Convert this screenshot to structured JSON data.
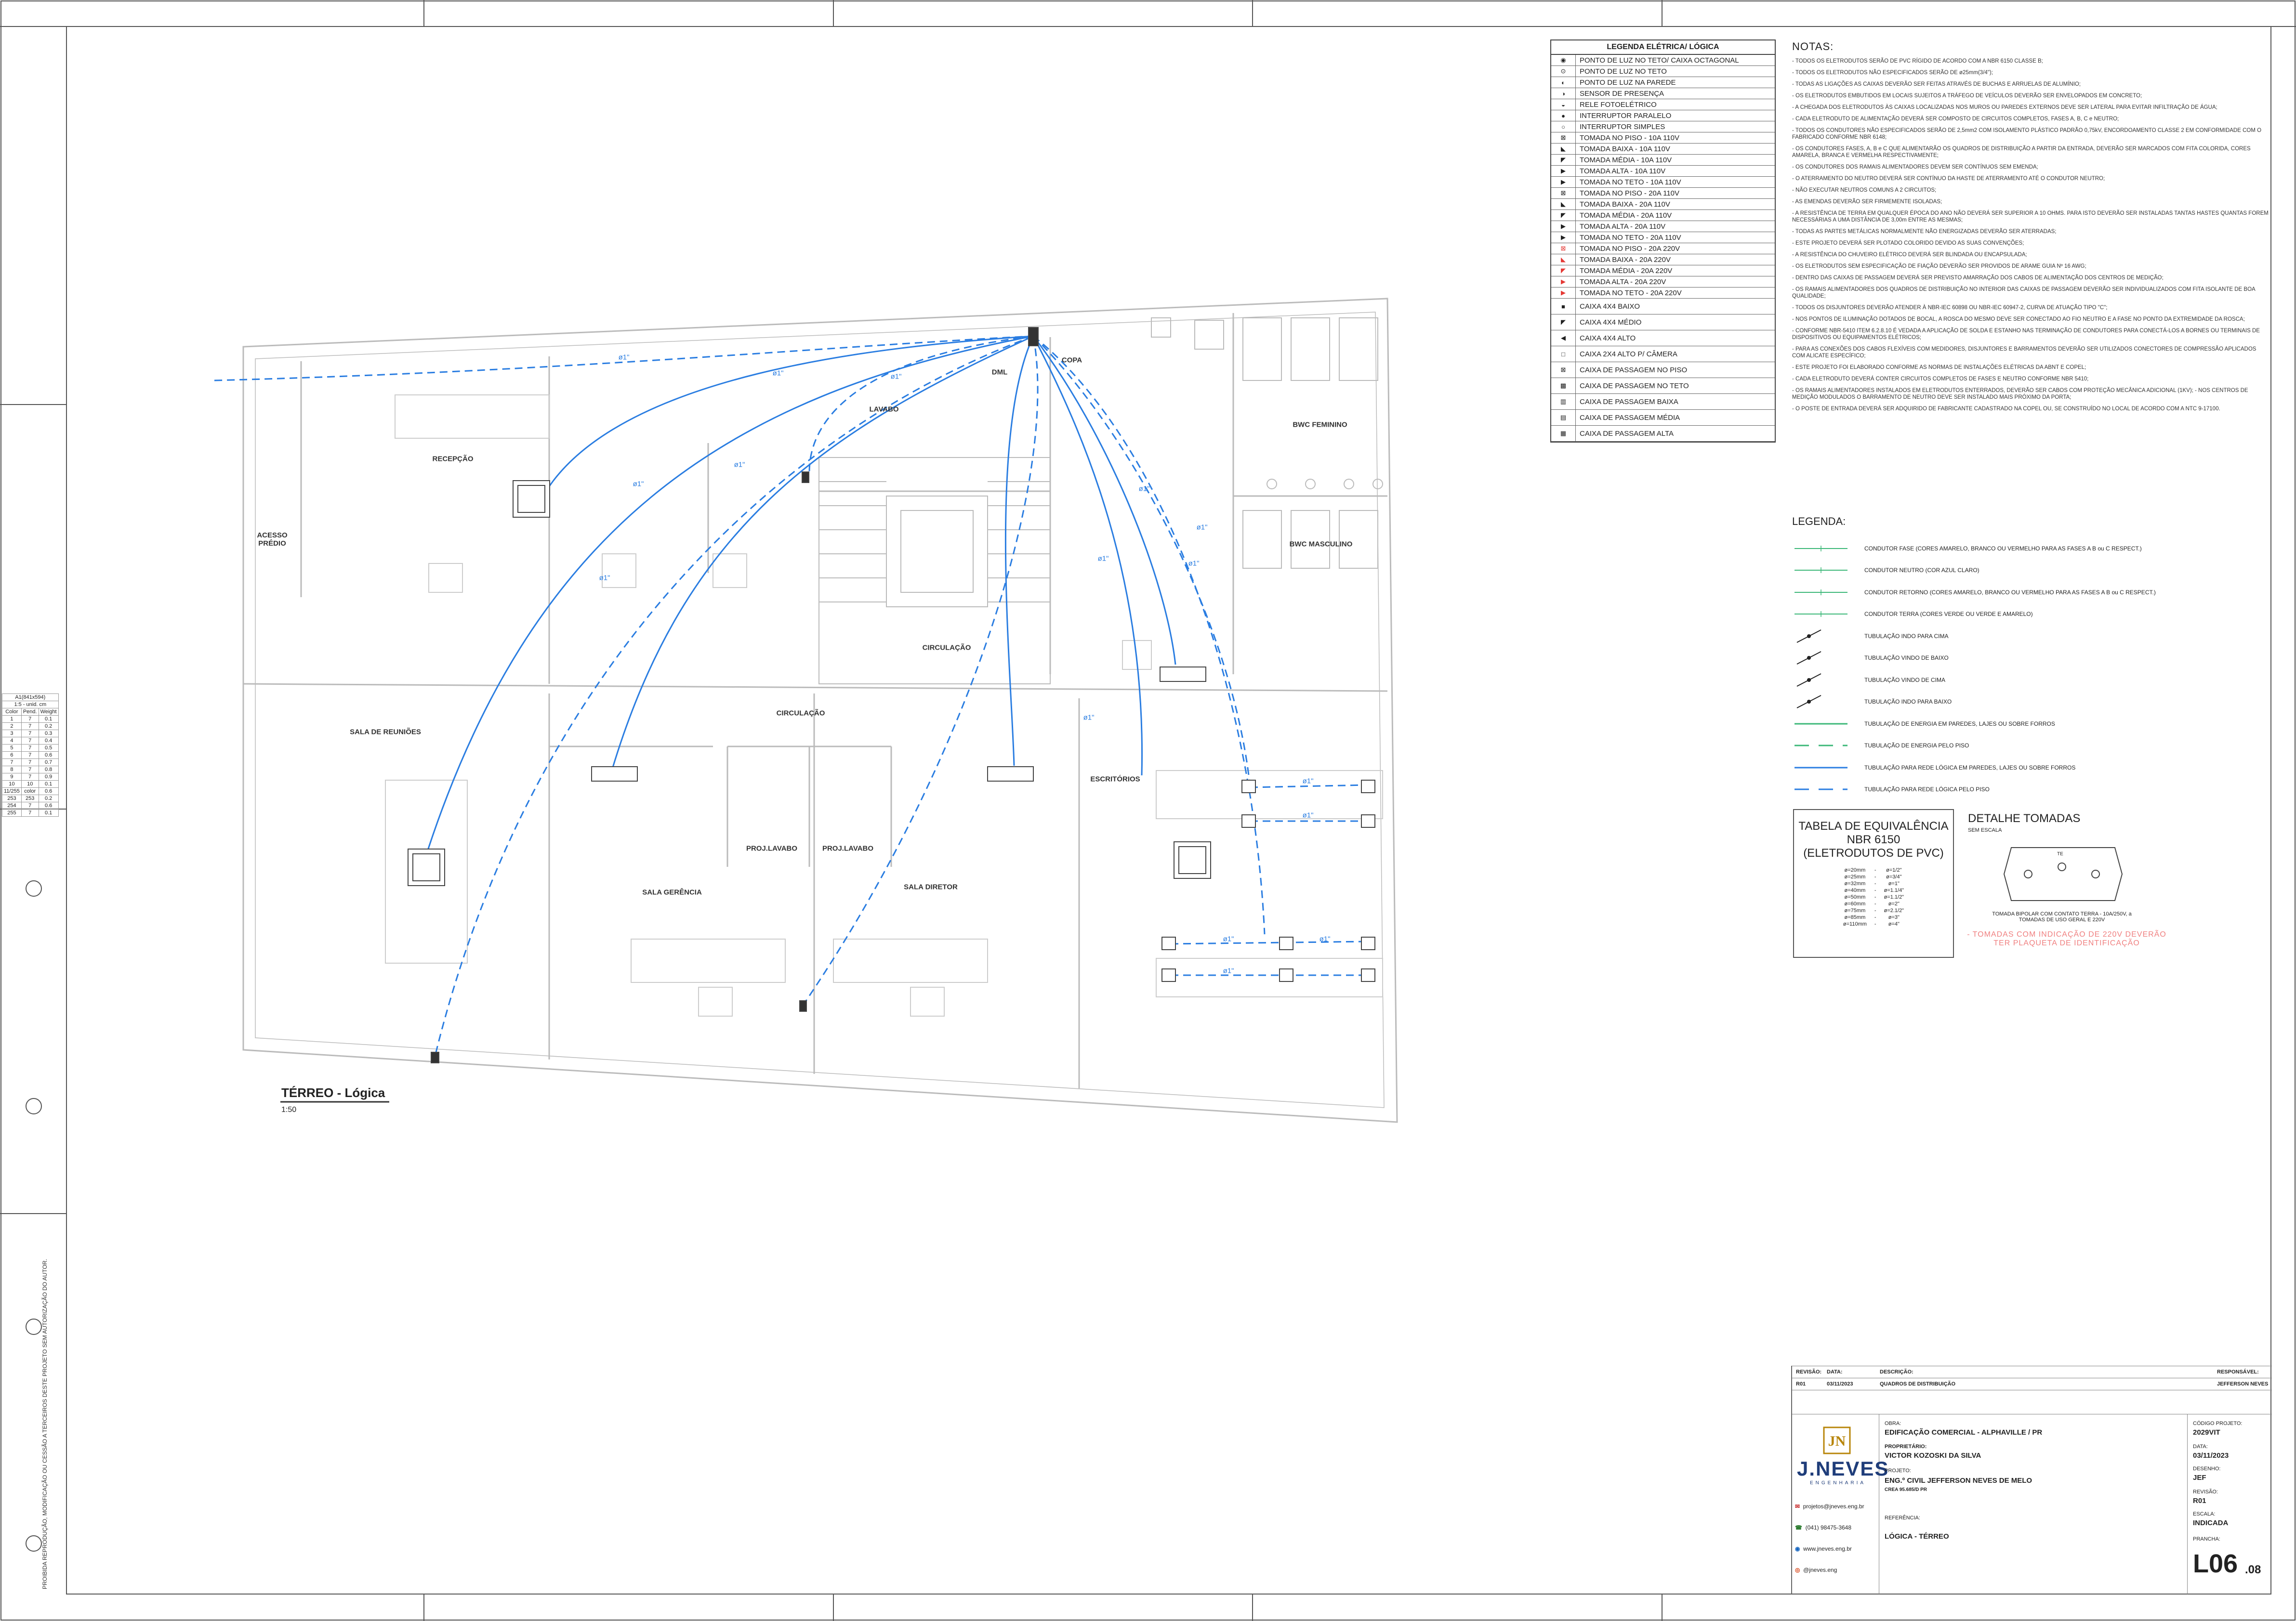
{
  "drawing": {
    "title": "TÉRREO - Lógica",
    "scale": "1:50"
  },
  "rooms": [
    {
      "key": "acesso",
      "label": "ACESSO PRÉDIO"
    },
    {
      "key": "recepcao",
      "label": "RECEPÇÃO"
    },
    {
      "key": "lavabo",
      "label": "LAVABO"
    },
    {
      "key": "dml",
      "label": "DML"
    },
    {
      "key": "copa",
      "label": "COPA"
    },
    {
      "key": "bwc_fem",
      "label": "BWC FEMININO"
    },
    {
      "key": "bwc_masc",
      "label": "BWC MASCULINO"
    },
    {
      "key": "circ1",
      "label": "CIRCULAÇÃO"
    },
    {
      "key": "circ2",
      "label": "CIRCULAÇÃO"
    },
    {
      "key": "reunioes",
      "label": "SALA DE REUNIÕES"
    },
    {
      "key": "escritorios",
      "label": "ESCRITÓRIOS"
    },
    {
      "key": "proj1",
      "label": "PROJ.LAVABO"
    },
    {
      "key": "proj2",
      "label": "PROJ.LAVABO"
    },
    {
      "key": "gerencia",
      "label": "SALA GERÊNCIA"
    },
    {
      "key": "diretor",
      "label": "SALA DIRETOR"
    }
  ],
  "conduit_labels": [
    "ø1\"",
    "ø1\"",
    "ø1\"",
    "ø1\"",
    "ø1\"",
    "ø1\"",
    "ø1\"",
    "ø1\"",
    "ø1\"",
    "ø1\"",
    "ø1\"",
    "ø1\"",
    "ø1\"",
    "ø1\"",
    "ø1\"",
    "ø1\""
  ],
  "legend_table": {
    "title": "LEGENDA ELÉTRICA/ LÓGICA",
    "items": [
      "PONTO DE LUZ NO TETO/ CAIXA OCTAGONAL",
      "PONTO DE LUZ NO TETO",
      "PONTO DE LUZ NA PAREDE",
      "SENSOR DE PRESENÇA",
      "RELE FOTOELÉTRICO",
      "INTERRUPTOR PARALELO",
      "INTERRUPTOR SIMPLES",
      "TOMADA NO PISO - 10A 110V",
      "TOMADA BAIXA - 10A 110V",
      "TOMADA MÉDIA - 10A 110V",
      "TOMADA ALTA - 10A 110V",
      "TOMADA NO TETO - 10A 110V",
      "TOMADA NO PISO - 20A 110V",
      "TOMADA BAIXA - 20A 110V",
      "TOMADA MÉDIA - 20A 110V",
      "TOMADA ALTA - 20A 110V",
      "TOMADA NO TETO - 20A 110V",
      "TOMADA NO PISO - 20A 220V",
      "TOMADA BAIXA - 20A 220V",
      "TOMADA MÉDIA - 20A 220V",
      "TOMADA ALTA - 20A 220V",
      "TOMADA NO TETO - 20A 220V",
      "CAIXA 4X4 BAIXO",
      "CAIXA 4X4 MÉDIO",
      "CAIXA 4X4 ALTO",
      "CAIXA 2X4 ALTO P/ CÂMERA",
      "CAIXA DE PASSAGEM NO PISO",
      "CAIXA DE PASSAGEM NO TETO",
      "CAIXA DE PASSAGEM BAIXA",
      "CAIXA DE PASSAGEM MÉDIA",
      "CAIXA DE PASSAGEM ALTA"
    ]
  },
  "notes": {
    "title": "NOTAS:",
    "items": [
      "- TODOS OS ELETRODUTOS SERÃO DE PVC RÍGIDO DE ACORDO COM A NBR 6150 CLASSE B;",
      "- TODOS OS ELETRODUTOS NÃO ESPECIFICADOS SERÃO DE ø25mm(3/4\");",
      "- TODAS AS LIGAÇÕES AS CAIXAS DEVERÃO SER FEITAS ATRAVÉS DE BUCHAS E ARRUELAS DE ALUMÍNIO;",
      "- OS ELETRODUTOS EMBUTIDOS EM LOCAIS SUJEITOS A TRÁFEGO DE VEÍCULOS DEVERÃO SER ENVELOPADOS EM CONCRETO;",
      "- A CHEGADA DOS ELETRODUTOS ÀS CAIXAS LOCALIZADAS NOS MUROS OU PAREDES EXTERNOS DEVE SER LATERAL PARA EVITAR INFILTRAÇÃO DE ÁGUA;",
      "- CADA ELETRODUTO DE ALIMENTAÇÃO DEVERÁ SER COMPOSTO DE CIRCUITOS COMPLETOS, FASES A, B, C e NEUTRO;",
      "- TODOS OS CONDUTORES NÃO ESPECIFICADOS SERÃO DE 2,5mm2 COM ISOLAMENTO PLÁSTICO PADRÃO 0,75kV, ENCORDOAMENTO CLASSE 2 EM CONFORMIDADE COM O FABRICADO CONFORME NBR 6148;",
      "- OS CONDUTORES FASES, A, B e C QUE ALIMENTARÃO OS QUADROS DE DISTRIBUIÇÃO A PARTIR DA ENTRADA, DEVERÃO SER MARCADOS COM FITA COLORIDA, CORES AMARELA, BRANCA E VERMELHA RESPECTIVAMENTE;",
      "- OS CONDUTORES DOS RAMAIS ALIMENTADORES DEVEM SER CONTÍNUOS SEM EMENDA;",
      "- O ATERRAMENTO DO NEUTRO DEVERÁ SER CONTÍNUO DA HASTE DE ATERRAMENTO ATÉ O CONDUTOR NEUTRO;",
      "- NÃO EXECUTAR NEUTROS COMUNS A 2 CIRCUITOS;",
      "- AS EMENDAS DEVERÃO SER FIRMEMENTE ISOLADAS;",
      "- A RESISTÊNCIA DE TERRA EM QUALQUER ÉPOCA DO ANO NÃO DEVERÁ SER SUPERIOR A 10 OHMS. PARA ISTO DEVERÃO SER INSTALADAS TANTAS HASTES QUANTAS FOREM NECESSÁRIAS A UMA DISTÂNCIA DE 3,00m ENTRE AS MESMAS;",
      "- TODAS AS PARTES METÁLICAS NORMALMENTE NÃO ENERGIZADAS DEVERÃO SER ATERRADAS;",
      "- ESTE PROJETO DEVERÁ SER PLOTADO COLORIDO DEVIDO AS SUAS CONVENÇÕES;",
      "- A RESISTÊNCIA DO CHUVEIRO ELÉTRICO DEVERÁ SER BLINDADA OU ENCAPSULADA;",
      "- OS ELETRODUTOS SEM ESPECIFICAÇÃO DE FIAÇÃO DEVERÃO SER PROVIDOS DE ARAME GUIA Nº 16 AWG;",
      "- DENTRO DAS CAIXAS DE PASSAGEM DEVERÁ SER PREVISTO AMARRAÇÃO DOS CABOS DE ALIMENTAÇÃO DOS CENTROS DE MEDIÇÃO;",
      "- OS RAMAIS ALIMENTADORES DOS QUADROS DE DISTRIBUIÇÃO NO INTERIOR DAS CAIXAS DE PASSAGEM DEVERÃO SER INDIVIDUALIZADOS COM FITA ISOLANTE DE BOA QUALIDADE;",
      "- TODOS OS DISJUNTORES DEVERÃO ATENDER À NBR-IEC 60898 OU NBR-IEC 60947-2, CURVA DE ATUAÇÃO TIPO \"C\";",
      "- NOS PONTOS DE ILUMINAÇÃO DOTADOS DE BOCAL, A ROSCA DO MESMO DEVE SER CONECTADO AO FIO NEUTRO E A FASE NO PONTO DA EXTREMIDADE DA ROSCA;",
      "- CONFORME NBR-5410 ITEM 6.2.8.10 É VEDADA A APLICAÇÃO DE SOLDA E ESTANHO NAS TERMINAÇÃO DE CONDUTORES PARA CONECTÁ-LOS A BORNES OU TERMINAIS DE DISPOSITIVOS OU EQUIPAMENTOS ELÉTRICOS;",
      "- PARA AS CONEXÕES DOS CABOS FLEXÍVEIS COM MEDIDORES, DISJUNTORES E BARRAMENTOS DEVERÃO SER UTILIZADOS CONECTORES DE COMPRESSÃO APLICADOS COM ALICATE ESPECÍFICO;",
      "- ESTE PROJETO FOI ELABORADO CONFORME AS NORMAS DE INSTALAÇÕES ELÉTRICAS DA ABNT E COPEL;",
      "- CADA ELETRODUTO DEVERÁ CONTER CIRCUITOS COMPLETOS DE FASES E NEUTRO CONFORME NBR 5410;",
      "- OS RAMAIS ALIMENTADORES INSTALADOS EM ELETRODUTOS ENTERRADOS, DEVERÃO SER CABOS COM PROTEÇÃO MECÂNICA ADICIONAL (1KV); - NOS CENTROS DE MEDIÇÃO MODULADOS O BARRAMENTO DE NEUTRO DEVE SER INSTALADO MAIS PRÓXIMO DA PORTA;",
      "- O POSTE DE ENTRADA DEVERÁ SER ADQUIRIDO DE FABRICANTE CADASTRADO NA COPEL OU, SE CONSTRUÍDO NO LOCAL DE ACORDO COM A NTC 9-17100."
    ]
  },
  "legend_lines": {
    "title": "LEGENDA:",
    "items": [
      {
        "text": "CONDUTOR FASE (CORES AMARELO, BRANCO OU VERMELHO PARA AS FASES A B ou C RESPECT.)",
        "style": "phase"
      },
      {
        "text": "CONDUTOR NEUTRO (COR AZUL CLARO)",
        "style": "neutral"
      },
      {
        "text": "CONDUTOR RETORNO (CORES AMARELO, BRANCO OU VERMELHO PARA AS FASES A B ou C RESPECT.)",
        "style": "return"
      },
      {
        "text": "CONDUTOR TERRA (CORES VERDE OU VERDE E AMARELO)",
        "style": "ground"
      },
      {
        "text": "TUBULAÇÃO INDO PARA CIMA",
        "style": "up"
      },
      {
        "text": "TUBULAÇÃO VINDO DE BAIXO",
        "style": "frombelow"
      },
      {
        "text": "TUBULAÇÃO VINDO DE CIMA",
        "style": "fromabove"
      },
      {
        "text": "TUBULAÇÃO INDO PARA BAIXO",
        "style": "down"
      },
      {
        "text": "TUBULAÇÃO DE ENERGIA EM PAREDES, LAJES OU SOBRE FORROS",
        "style": "green-solid"
      },
      {
        "text": "TUBULAÇÃO DE ENERGIA PELO PISO",
        "style": "green-dash"
      },
      {
        "text": "TUBULAÇÃO PARA REDE LÓGICA EM PAREDES, LAJES OU SOBRE FORROS",
        "style": "blue-solid"
      },
      {
        "text": "TUBULAÇÃO PARA REDE LÓGICA PELO PISO",
        "style": "blue-dash"
      }
    ]
  },
  "equivalence": {
    "title_lines": [
      "TABELA DE EQUIVALÊNCIA",
      "NBR 6150",
      "(ELETRODUTOS DE PVC)"
    ],
    "rows": [
      [
        "ø=20mm",
        "-",
        "ø=1/2\""
      ],
      [
        "ø=25mm",
        "-",
        "ø=3/4\""
      ],
      [
        "ø=32mm",
        "-",
        "ø=1\""
      ],
      [
        "ø=40mm",
        "-",
        "ø=1.1/4\""
      ],
      [
        "ø=50mm",
        "-",
        "ø=1.1/2\""
      ],
      [
        "ø=60mm",
        "-",
        "ø=2\""
      ],
      [
        "ø=75mm",
        "-",
        "ø=2.1/2\""
      ],
      [
        "ø=85mm",
        "-",
        "ø=3\""
      ],
      [
        "ø=110mm",
        "-",
        "ø=4\""
      ]
    ]
  },
  "detail": {
    "title": "DETALHE TOMADAS",
    "subtitle": "SEM ESCALA",
    "caption1": "TOMADA BIPOLAR COM CONTATO TERRA - 10A/250V, a",
    "caption2": "TOMADAS DE USO GERAL E 220V",
    "warning1": "- TOMADAS COM INDICAÇÃO DE 220V DEVERÃO",
    "warning2": "TER PLAQUETA DE IDENTIFICAÇÃO",
    "socket_label": "TE",
    "warning_color": "#f08080"
  },
  "scale_table": {
    "header": [
      "A1(841x594)",
      "1:5 - unid. cm"
    ],
    "cols": [
      "Color",
      "Pend.",
      "Weight"
    ],
    "rows": [
      [
        "1",
        "7",
        "0.1"
      ],
      [
        "2",
        "7",
        "0.2"
      ],
      [
        "3",
        "7",
        "0.3"
      ],
      [
        "4",
        "7",
        "0.4"
      ],
      [
        "5",
        "7",
        "0.5"
      ],
      [
        "6",
        "7",
        "0.6"
      ],
      [
        "7",
        "7",
        "0.7"
      ],
      [
        "8",
        "7",
        "0.8"
      ],
      [
        "9",
        "7",
        "0.9"
      ],
      [
        "10",
        "10",
        "0.1"
      ],
      [
        "11/255",
        "color",
        "0.6"
      ],
      [
        "253",
        "253",
        "0.2"
      ],
      [
        "254",
        "7",
        "0.6"
      ],
      [
        "255",
        "7",
        "0.1"
      ]
    ]
  },
  "side_text": "PROIBIDA REPRODUÇÃO, MODIFICAÇÃO OU CESSÃO A TERCEIROS DESTE PROJETO SEM AUTORIZAÇÃO DO AUTOR.",
  "title_block": {
    "rev_headers": [
      "REVISÃO:",
      "DATA:",
      "DESCRIÇÃO:",
      "RESPONSÁVEL:"
    ],
    "rev_row": [
      "R01",
      "03/11/2023",
      "QUADROS DE DISTRIBUIÇÃO",
      "JEFFERSON NEVES"
    ],
    "company": "J.NEVES",
    "company_sub": "ENGENHARIA",
    "obra_label": "OBRA:",
    "obra": "EDIFICAÇÃO COMERCIAL - ALPHAVILLE / PR",
    "proprietario_label": "PROPRIETÁRIO:",
    "proprietario": "VICTOR KOZOSKI DA SILVA",
    "projeto_label": "PROJETO:",
    "projeto": "ENG.º CIVIL JEFFERSON NEVES DE MELO",
    "crea": "CREA 95.685/D PR",
    "referencia_label": "REFERÊNCIA:",
    "referencia": "LÓGICA - TÉRREO",
    "codigo_label": "CÓDIGO PROJETO:",
    "codigo": "2029VIT",
    "data_label": "DATA:",
    "data": "03/11/2023",
    "desenho_label": "DESENHO:",
    "desenho": "JEF",
    "revisao_label": "REVISÃO:",
    "revisao": "R01",
    "escala_label": "ESCALA:",
    "escala": "INDICADA",
    "prancha_label": "PRANCHA:",
    "prancha": "L06",
    "prancha_sub": ".08",
    "email": "projetos@jneves.eng.br",
    "phone": "(041) 98475-3648",
    "site": "www.jneves.eng.br",
    "instagram": "@jneves.eng"
  },
  "colors": {
    "logic_conduit": "#2a7de1",
    "green_conduit": "#3cb878",
    "wall": "#bbbbbb",
    "logo_gold": "#b8860b",
    "logo_blue": "#1f3d7a"
  }
}
